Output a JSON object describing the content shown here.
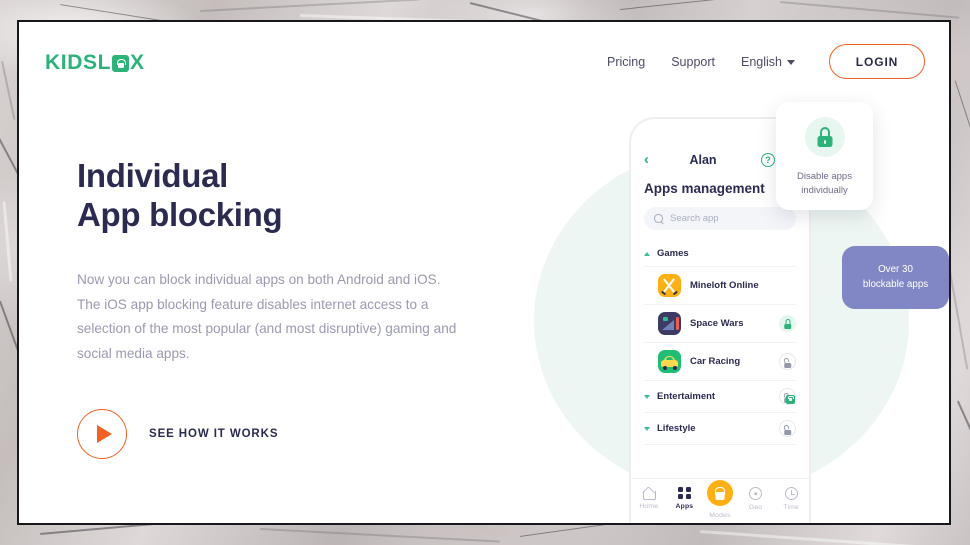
{
  "brand": {
    "name_part1": "KIDSL",
    "name_part2": "X",
    "logo_icon": "lock-icon",
    "color": "#2db37a"
  },
  "header": {
    "nav_links": [
      {
        "label": "Pricing"
      },
      {
        "label": "Support"
      }
    ],
    "language": {
      "label": "English",
      "icon": "chevron-down-icon"
    },
    "login_label": "LOGIN",
    "login_border_color": "#f26122"
  },
  "hero": {
    "title_line1": "Individual",
    "title_line2": "App blocking",
    "title_color": "#2b2b52",
    "body": "Now you can block individual apps on both Android and iOS. The iOS app blocking feature disables internet access to a selection of the most popular (and most disruptive) gaming and social media apps.",
    "cta_label": "SEE HOW IT WORKS",
    "cta_icon": "play-icon",
    "accent_color": "#f26122"
  },
  "phone": {
    "topbar": {
      "back_icon": "chevron-left-icon",
      "title": "Alan",
      "help_icon": "question-circle-icon",
      "help_glyph": "?",
      "bell_icon": "bell-icon"
    },
    "screen_title": "Apps management",
    "search": {
      "placeholder": "Search app",
      "icon": "search-icon"
    },
    "categories": [
      {
        "label": "Games",
        "expanded": true,
        "chevron": "chevron-up-icon",
        "lock_state": "none",
        "apps": [
          {
            "name": "Mineloft Online",
            "icon": "crossed-swords-icon",
            "icon_color": "#ffb114",
            "lock_state": "none"
          },
          {
            "name": "Space Wars",
            "icon": "spaceship-icon",
            "icon_color": "#3d3a63",
            "lock_state": "locked"
          },
          {
            "name": "Car Racing",
            "icon": "car-icon",
            "icon_color": "#22bd74",
            "lock_state": "unlocked"
          }
        ]
      },
      {
        "label": "Entertaiment",
        "expanded": false,
        "chevron": "chevron-down-icon",
        "lock_state": "mixed",
        "apps": []
      },
      {
        "label": "Lifestyle",
        "expanded": false,
        "chevron": "chevron-down-icon",
        "lock_state": "unlocked",
        "apps": []
      }
    ],
    "bottom_nav": [
      {
        "label": "Home",
        "icon": "home-icon",
        "active": false
      },
      {
        "label": "Apps",
        "icon": "grid-icon",
        "active": true
      },
      {
        "label": "Modes",
        "icon": "lock-icon",
        "active": false
      },
      {
        "label": "Geo",
        "icon": "pin-icon",
        "active": false
      },
      {
        "label": "Time",
        "icon": "clock-icon",
        "active": false
      }
    ]
  },
  "callouts": {
    "disable_card": {
      "icon": "lock-icon",
      "text_line1": "Disable apps",
      "text_line2": "individually",
      "icon_color": "#2db37a"
    },
    "count_badge": {
      "text_line1": "Over 30",
      "text_line2": "blockable apps",
      "background": "#8187c4"
    }
  }
}
